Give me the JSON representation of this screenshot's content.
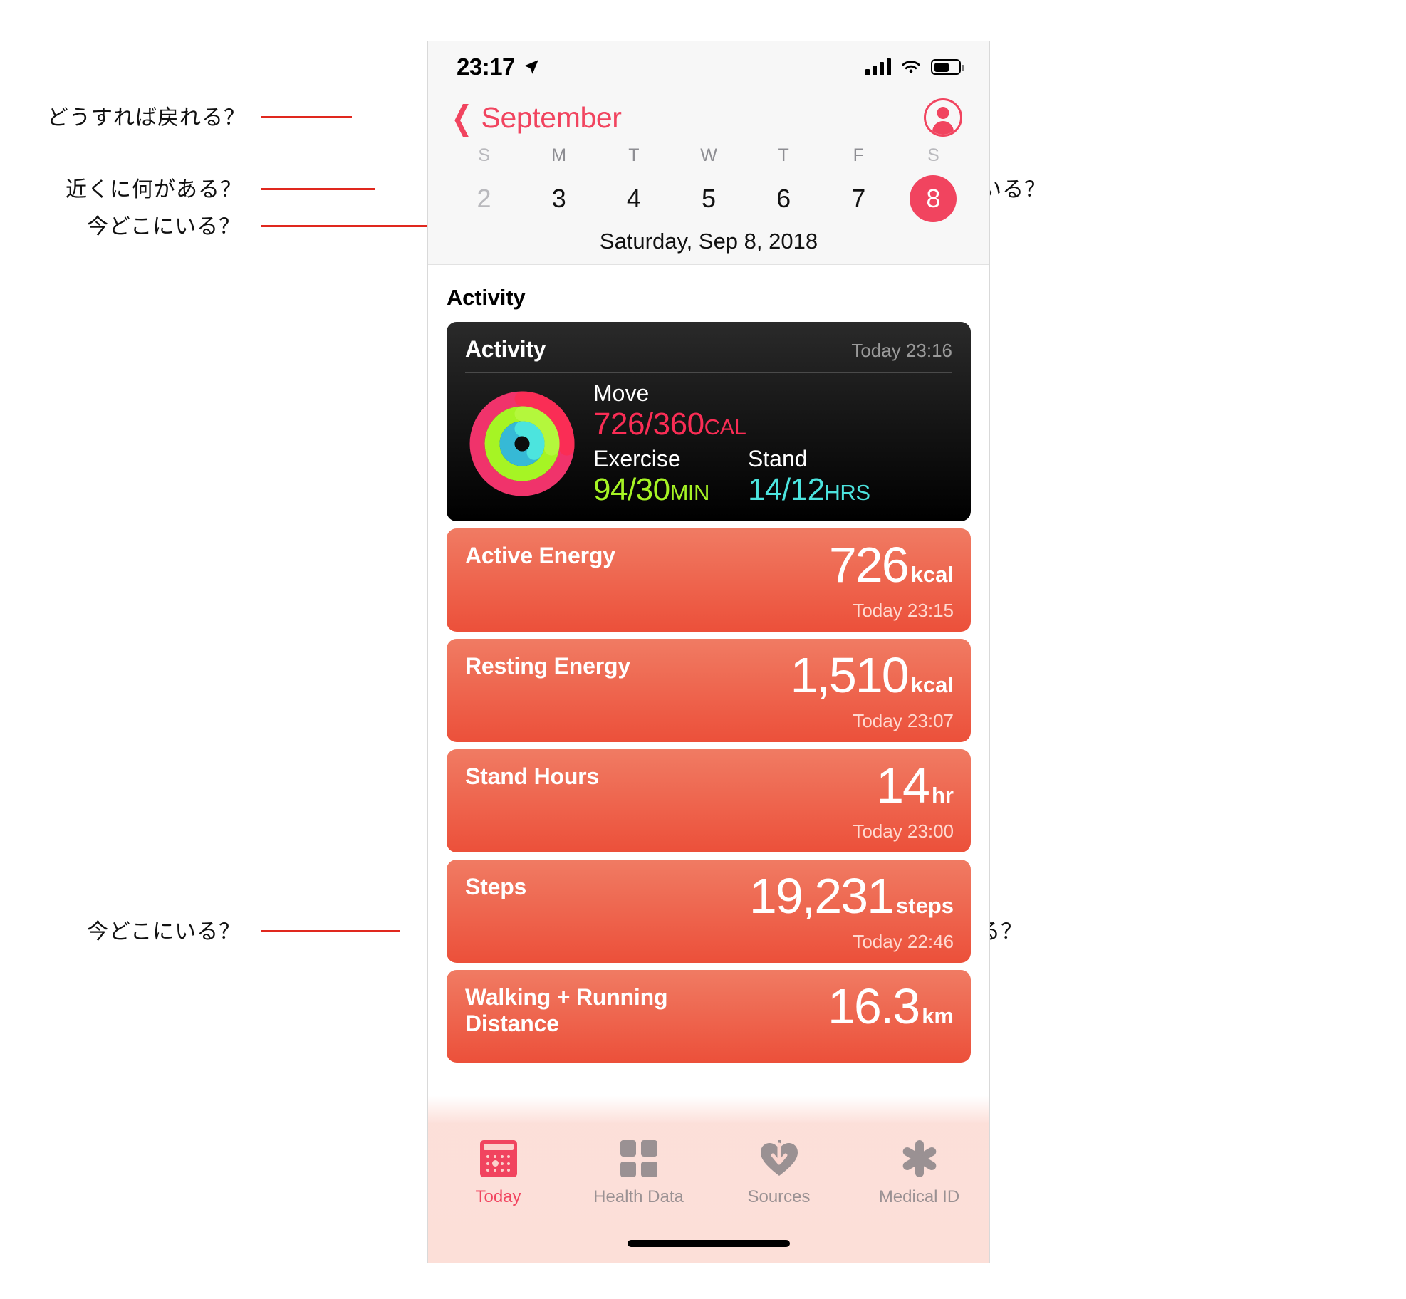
{
  "status_bar": {
    "time": "23:17",
    "location_icon": "location-arrow-icon",
    "signal_icon": "cellular-bars-icon",
    "wifi_icon": "wifi-icon",
    "battery_icon": "battery-icon"
  },
  "nav": {
    "back_icon": "chevron-left-icon",
    "back_label": "September",
    "profile_icon": "profile-avatar-icon"
  },
  "calendar": {
    "day_initials": [
      "S",
      "M",
      "T",
      "W",
      "T",
      "F",
      "S"
    ],
    "days": [
      {
        "num": "2",
        "state": "dimmed"
      },
      {
        "num": "3",
        "state": "normal"
      },
      {
        "num": "4",
        "state": "normal"
      },
      {
        "num": "5",
        "state": "normal"
      },
      {
        "num": "6",
        "state": "normal"
      },
      {
        "num": "7",
        "state": "normal"
      },
      {
        "num": "8",
        "state": "selected"
      }
    ],
    "full_date": "Saturday, Sep 8, 2018"
  },
  "section": {
    "title": "Activity"
  },
  "activity_card": {
    "title": "Activity",
    "timestamp": "Today 23:16",
    "move_label": "Move",
    "move_value": "726/360",
    "move_unit": "CAL",
    "exercise_label": "Exercise",
    "exercise_value": "94/30",
    "exercise_unit": "MIN",
    "stand_label": "Stand",
    "stand_value": "14/12",
    "stand_unit": "HRS",
    "ring_colors": {
      "move": "#fa2d55",
      "exercise": "#a6f424",
      "stand": "#4ce4de"
    }
  },
  "metric_cards": [
    {
      "name": "Active Energy",
      "value": "726",
      "unit": "kcal",
      "time": "Today 23:15"
    },
    {
      "name": "Resting Energy",
      "value": "1,510",
      "unit": "kcal",
      "time": "Today 23:07"
    },
    {
      "name": "Stand Hours",
      "value": "14",
      "unit": "hr",
      "time": "Today 23:00"
    },
    {
      "name": "Steps",
      "value": "19,231",
      "unit": "steps",
      "time": "Today 22:46"
    },
    {
      "name": "Walking + Running Distance",
      "value": "16.3",
      "unit": "km",
      "time": ""
    }
  ],
  "tab_bar": {
    "tabs": [
      {
        "label": "Today",
        "icon": "calendar-today-icon",
        "active": true
      },
      {
        "label": "Health Data",
        "icon": "grid-squares-icon",
        "active": false
      },
      {
        "label": "Sources",
        "icon": "heart-download-icon",
        "active": false
      },
      {
        "label": "Medical ID",
        "icon": "medical-asterisk-icon",
        "active": false
      }
    ]
  },
  "annotations": {
    "left": [
      {
        "text": "どうすれば戻れる？"
      },
      {
        "text": "近くに何がある？"
      },
      {
        "text": "今どこにいる？"
      },
      {
        "text": "今どこにいる？"
      }
    ],
    "right": [
      {
        "text": "今どこにいる？"
      },
      {
        "text": "どこへ行ける？"
      }
    ]
  },
  "colors": {
    "accent": "#f1445f",
    "card_orange_top": "#f07b63",
    "card_orange_bottom": "#ec503a",
    "annotation_line": "#e0281e"
  }
}
